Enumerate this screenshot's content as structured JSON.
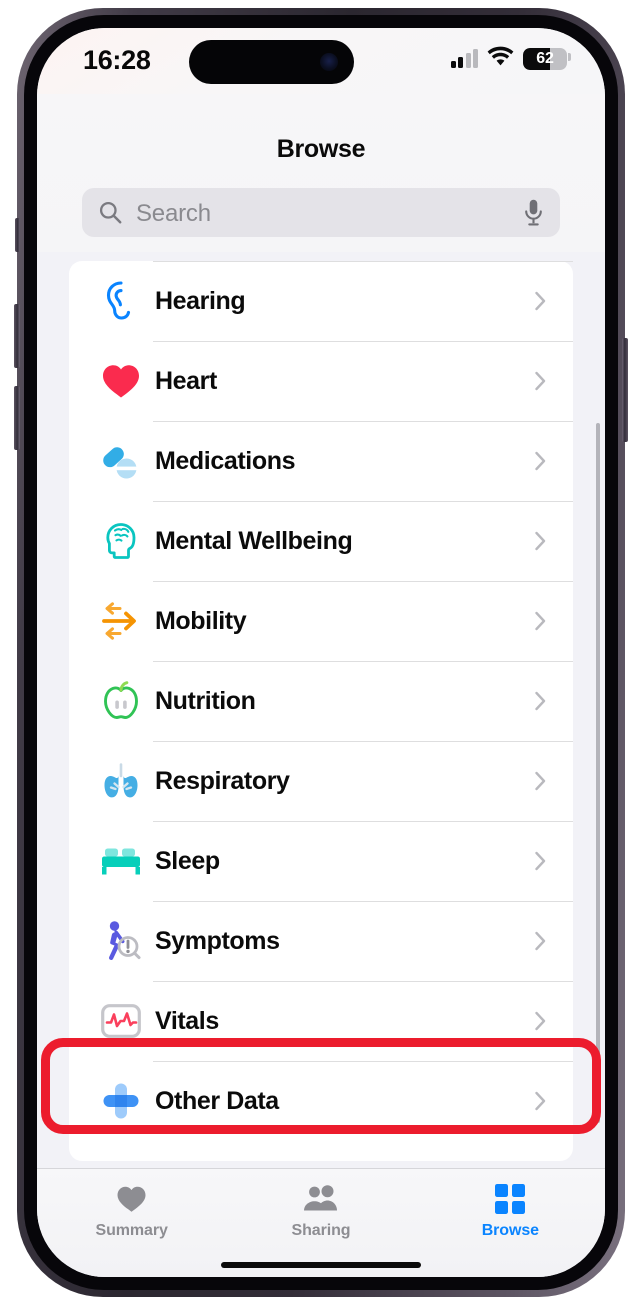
{
  "status_bar": {
    "time": "16:28",
    "battery_percent": "62",
    "battery_level": 62,
    "signal_bars_on": 2,
    "signal_bars_total": 4,
    "wifi_icon": "wifi-icon",
    "battery_icon": "battery-icon"
  },
  "header": {
    "title": "Browse"
  },
  "search": {
    "placeholder": "Search",
    "value": "",
    "search_icon": "search-icon",
    "mic_icon": "microphone-icon"
  },
  "list": {
    "items": [
      {
        "label": "Hearing",
        "icon": "ear-icon",
        "color": "#0a84ff",
        "highlighted": false
      },
      {
        "label": "Heart",
        "icon": "heart-icon",
        "color": "#fa2b4e",
        "highlighted": false
      },
      {
        "label": "Medications",
        "icon": "pills-icon",
        "color": "#32ade6",
        "highlighted": false
      },
      {
        "label": "Mental Wellbeing",
        "icon": "brain-head-icon",
        "color": "#0ac5c0",
        "highlighted": false
      },
      {
        "label": "Mobility",
        "icon": "arrows-icon",
        "color": "#f59403",
        "highlighted": false
      },
      {
        "label": "Nutrition",
        "icon": "apple-icon",
        "color": "#30c355",
        "highlighted": false
      },
      {
        "label": "Respiratory",
        "icon": "lungs-icon",
        "color": "#45aee4",
        "highlighted": false
      },
      {
        "label": "Sleep",
        "icon": "bed-icon",
        "color": "#07cfba",
        "highlighted": true
      },
      {
        "label": "Symptoms",
        "icon": "walking-person-icon",
        "color": "#5a5ae0",
        "highlighted": false
      },
      {
        "label": "Vitals",
        "icon": "ecg-waveform-icon",
        "color": "#fa3f5c",
        "highlighted": false
      },
      {
        "label": "Other Data",
        "icon": "plus-cross-icon",
        "color": "#3e92f5",
        "highlighted": false
      }
    ],
    "chevron_icon": "chevron-right-icon",
    "highlight_color": "#ec1c2d"
  },
  "tab_bar": {
    "active_color": "#0a84ff",
    "inactive_color": "#8d8d92",
    "tabs": [
      {
        "label": "Summary",
        "icon": "heart-filled-icon",
        "active": false
      },
      {
        "label": "Sharing",
        "icon": "people-icon",
        "active": false
      },
      {
        "label": "Browse",
        "icon": "grid-squares-icon",
        "active": true
      }
    ]
  }
}
